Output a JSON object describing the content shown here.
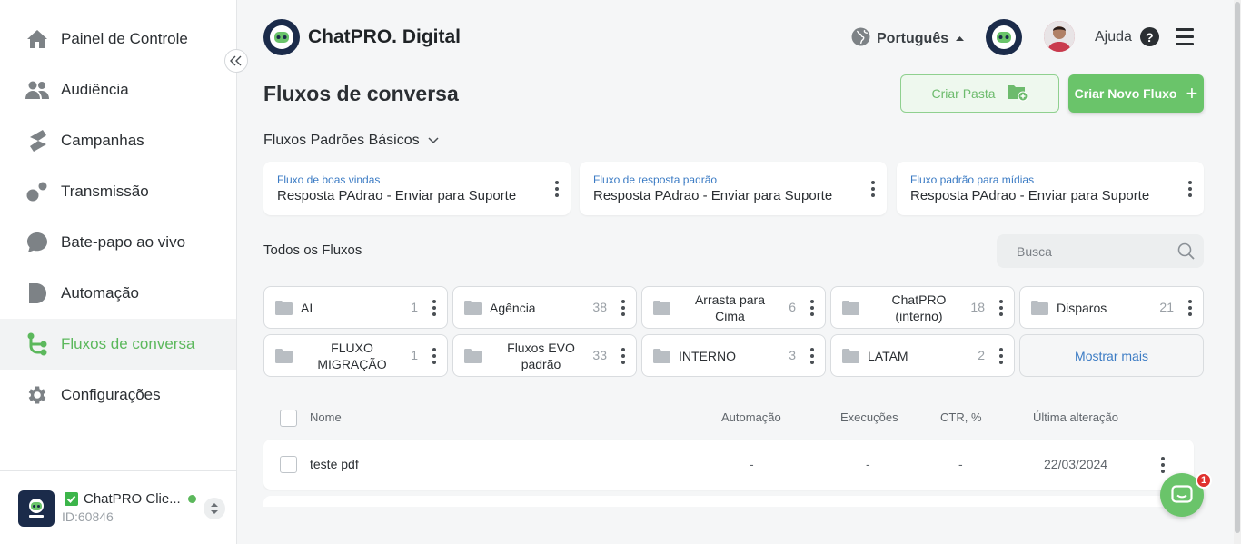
{
  "sidebar": {
    "items": [
      {
        "label": "Painel de Controle",
        "icon": "home-icon"
      },
      {
        "label": "Audiência",
        "icon": "users-icon"
      },
      {
        "label": "Campanhas",
        "icon": "campaign-icon"
      },
      {
        "label": "Transmissão",
        "icon": "broadcast-icon"
      },
      {
        "label": "Bate-papo ao vivo",
        "icon": "chat-bubble-icon"
      },
      {
        "label": "Automação",
        "icon": "automation-icon"
      },
      {
        "label": "Fluxos de conversa",
        "icon": "flow-icon",
        "active": true
      },
      {
        "label": "Configurações",
        "icon": "gear-icon"
      }
    ],
    "account": {
      "name": "ChatPRO Clie...",
      "id": "ID:60846"
    }
  },
  "header": {
    "brand": "ChatPRO. Digital",
    "language": "Português",
    "help": "Ajuda"
  },
  "page": {
    "title": "Fluxos de conversa",
    "create_folder": "Criar Pasta",
    "create_flow": "Criar Novo Fluxo"
  },
  "defaults": {
    "heading": "Fluxos Padrões Básicos",
    "cards": [
      {
        "label": "Fluxo de boas vindas",
        "value": "Resposta PAdrao - Enviar para Suporte"
      },
      {
        "label": "Fluxo de resposta padrão",
        "value": "Resposta PAdrao - Enviar para Suporte"
      },
      {
        "label": "Fluxo padrão para mídias",
        "value": "Resposta PAdrao - Enviar para Suporte"
      }
    ]
  },
  "all_flows": {
    "heading": "Todos os Fluxos",
    "search_placeholder": "Busca",
    "folders": [
      {
        "name": "AI",
        "count": "1"
      },
      {
        "name": "Agência",
        "count": "38"
      },
      {
        "name": "Arrasta para Cima",
        "count": "6"
      },
      {
        "name": "ChatPRO (interno)",
        "count": "18"
      },
      {
        "name": "Disparos",
        "count": "21"
      },
      {
        "name": "FLUXO MIGRAÇÃO",
        "count": "1"
      },
      {
        "name": "Fluxos EVO padrão",
        "count": "33"
      },
      {
        "name": "INTERNO",
        "count": "3"
      },
      {
        "name": "LATAM",
        "count": "2"
      }
    ],
    "show_more": "Mostrar mais"
  },
  "table": {
    "columns": [
      "Nome",
      "Automação",
      "Execuções",
      "CTR, %",
      "Última alteração"
    ],
    "rows": [
      {
        "name": "teste pdf",
        "automation": "-",
        "executions": "-",
        "ctr": "-",
        "modified": "22/03/2024"
      }
    ]
  },
  "chat_widget": {
    "badge": "1"
  },
  "colors": {
    "accent": "#5cb85c",
    "link": "#3b7bc4",
    "badge": "#e0322f"
  }
}
